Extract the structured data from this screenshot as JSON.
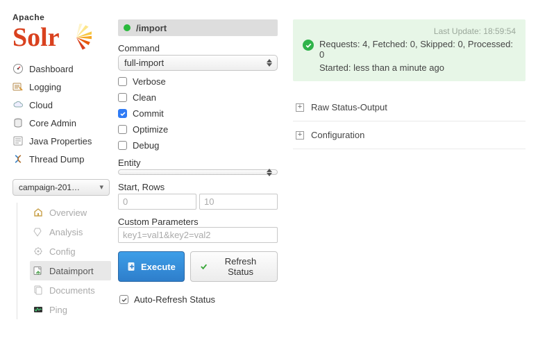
{
  "logo": {
    "apache": "Apache",
    "solr": "Solr"
  },
  "nav1": {
    "dashboard": "Dashboard",
    "logging": "Logging",
    "cloud": "Cloud",
    "coreadmin": "Core Admin",
    "javaprops": "Java Properties",
    "threaddump": "Thread Dump"
  },
  "core_selector": "campaign-201…",
  "nav2": {
    "overview": "Overview",
    "analysis": "Analysis",
    "config": "Config",
    "dataimport": "Dataimport",
    "documents": "Documents",
    "ping": "Ping"
  },
  "handler": {
    "path": "/import"
  },
  "form": {
    "command_label": "Command",
    "command_value": "full-import",
    "verbose": "Verbose",
    "clean": "Clean",
    "commit": "Commit",
    "optimize": "Optimize",
    "debug": "Debug",
    "entity_label": "Entity",
    "entity_value": "",
    "startrows_label": "Start, Rows",
    "start_ph": "0",
    "rows_ph": "10",
    "custom_label": "Custom Parameters",
    "custom_ph": "key1=val1&key2=val2",
    "execute": "Execute",
    "refresh": "Refresh Status",
    "auto": "Auto-Refresh Status"
  },
  "status": {
    "last_update": "Last Update: 18:59:54",
    "line1": "Requests: 4, Fetched: 0, Skipped: 0, Processed: 0",
    "line2": "Started: less than a minute ago"
  },
  "acc": {
    "raw": "Raw Status-Output",
    "config": "Configuration"
  }
}
